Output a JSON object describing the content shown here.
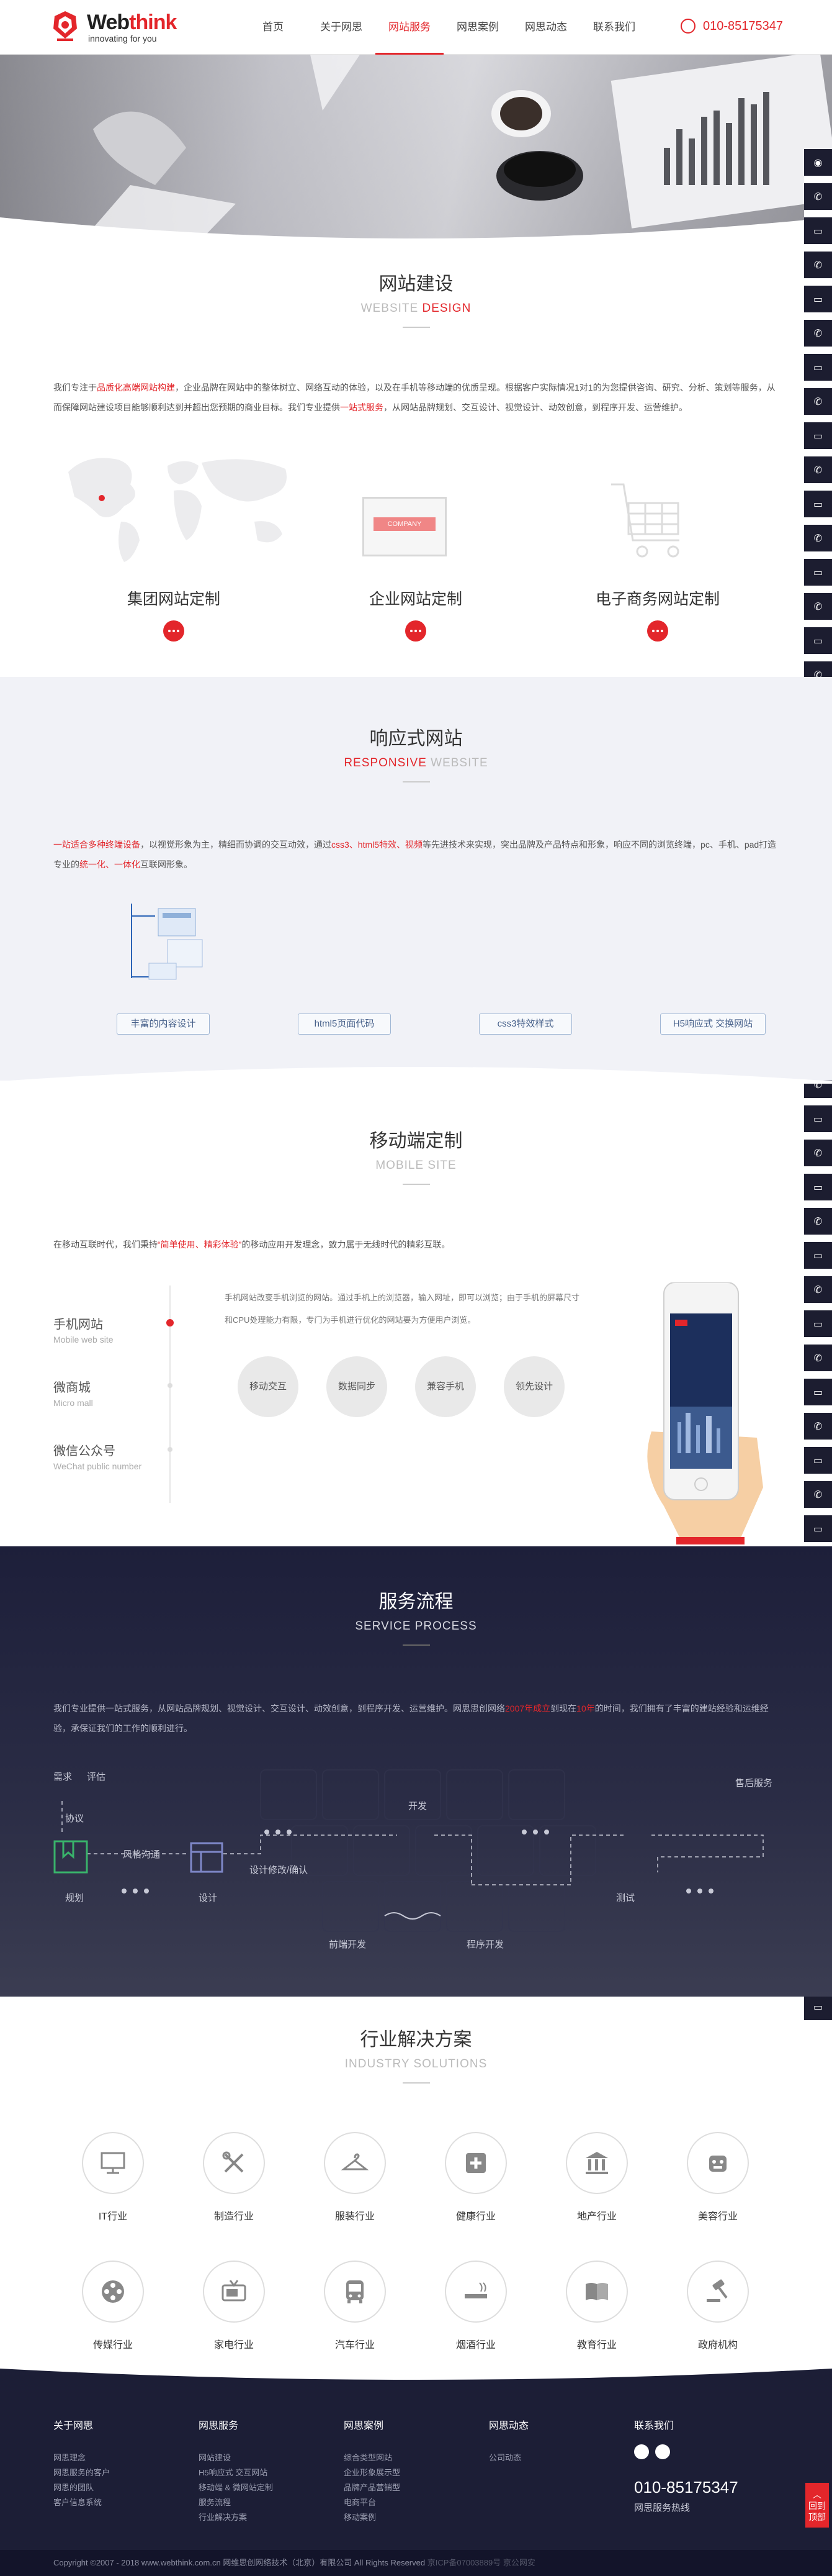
{
  "header": {
    "logo_main": "Web",
    "logo_accent": "think",
    "logo_slogan": "innovating for you",
    "nav": [
      "首页",
      "关于网思",
      "网站服务",
      "网思案例",
      "网思动态",
      "联系我们"
    ],
    "nav_active": 2,
    "phone": "010-85175347"
  },
  "website_design": {
    "title_zh": "网站建设",
    "title_en_1": "WEBSITE",
    "title_en_2": " DESIGN",
    "para_1": "我们专注于",
    "para_red_1": "品质化高端网站构建",
    "para_2": "，企业品牌在网站中的整体树立、网络互动的体验，以及在手机等移动端的优质呈现。根据客户实际情况1对1的为您提供咨询、研究、分析、策划等服务，从而保障网站建设项目能够顺利达到并超出您预期的商业目标。我们专业提供",
    "para_red_2": "一站式服务",
    "para_3": "，从网站品牌规划、交互设计、视觉设计、动效创意，到程序开发、运营维护。",
    "features": [
      {
        "label": "集团网站定制"
      },
      {
        "label": "企业网站定制",
        "badge": "COMPANY"
      },
      {
        "label": "电子商务网站定制"
      }
    ]
  },
  "responsive": {
    "title_zh": "响应式网站",
    "title_en_1": "RESPONSIVE",
    "title_en_2": " WEBSITE",
    "para_red_1": "一站适合多种终端设备",
    "para_1": "，以视觉形象为主，精细而协调的交互动效，通过",
    "para_red_2": "css3、html5特效、视频",
    "para_2": "等先进技术来实现，突出品牌及产品特点和形象，响应不同的浏览终端，pc、手机、pad打造专业的",
    "para_red_3": "统一化、一体化",
    "para_3": "互联网形象。",
    "pills": [
      "丰富的内容设计",
      "html5页面代码",
      "css3特效样式",
      "H5响应式 交换网站"
    ]
  },
  "mobile": {
    "title_zh": "移动端定制",
    "title_en": "MOBILE SITE",
    "intro_1": "在移动互联时代，我们秉持",
    "intro_red": "“简单使用、精彩体验”",
    "intro_2": "的移动应用开发理念，致力属于无线时代的精彩互联。",
    "menu": [
      {
        "zh": "手机网站",
        "en": "Mobile web site"
      },
      {
        "zh": "微商城",
        "en": "Micro mall"
      },
      {
        "zh": "微信公众号",
        "en": "WeChat public number"
      }
    ],
    "desc": "手机网站改变手机浏览的网站。通过手机上的浏览器，输入网址，即可以浏览；由于手机的屏幕尺寸和CPU处理能力有限，专门为手机进行优化的网站要为方便用户浏览。",
    "circles": [
      "移动交互",
      "数据同步",
      "兼容手机",
      "领先设计"
    ]
  },
  "process": {
    "title_zh": "服务流程",
    "title_en": "SERVICE PROCESS",
    "para_1": "我们专业提供一站式服务，从网站品牌规划、视觉设计、交互设计、动效创意，到程序开发、运营维护。网思思创网络",
    "para_red_1": "2007年成立",
    "para_2": "到现在",
    "para_red_2": "10年",
    "para_3": "的时间，我们拥有了丰富的建站经验和运维经验，承保证我们的工作的顺利进行。",
    "labels": {
      "demand": "需求",
      "evaluate": "评估",
      "protocol": "协议",
      "plan": "规划",
      "comm": "风格沟通",
      "design": "设计",
      "revise": "设计修改/确认",
      "develop": "开发",
      "front": "前端开发",
      "program": "程序开发",
      "test": "测试",
      "after": "售后服务"
    }
  },
  "industry": {
    "title_zh": "行业解决方案",
    "title_en": "INDUSTRY SOLUTIONS",
    "items": [
      {
        "label": "IT行业",
        "icon": "monitor-icon"
      },
      {
        "label": "制造行业",
        "icon": "tools-icon"
      },
      {
        "label": "服装行业",
        "icon": "hanger-icon"
      },
      {
        "label": "健康行业",
        "icon": "medical-cross-icon"
      },
      {
        "label": "地产行业",
        "icon": "building-icon"
      },
      {
        "label": "美容行业",
        "icon": "cosmetics-icon"
      },
      {
        "label": "传媒行业",
        "icon": "film-reel-icon"
      },
      {
        "label": "家电行业",
        "icon": "tv-icon"
      },
      {
        "label": "汽车行业",
        "icon": "bus-icon"
      },
      {
        "label": "烟酒行业",
        "icon": "cigarette-icon"
      },
      {
        "label": "教育行业",
        "icon": "book-icon"
      },
      {
        "label": "政府机构",
        "icon": "gavel-icon"
      }
    ]
  },
  "footer": {
    "cols": [
      {
        "title": "关于网思",
        "items": [
          "网思理念",
          "网思服务的客户",
          "网思的团队",
          "客户信息系统"
        ]
      },
      {
        "title": "网思服务",
        "items": [
          "网站建设",
          "H5响应式 交互网站",
          "移动端 & 微网站定制",
          "服务流程",
          "行业解决方案"
        ]
      },
      {
        "title": "网思案例",
        "items": [
          "综合类型网站",
          "企业形象展示型",
          "品牌产品营销型",
          "电商平台",
          "移动案例"
        ]
      },
      {
        "title": "网思动态",
        "items": [
          "公司动态"
        ]
      }
    ],
    "contact_title": "联系我们",
    "phone": "010-85175347",
    "hotline": "网思服务热线",
    "copyright": "Copyright ©2007 - 2018 www.webthink.com.cn 网维思创网络技术（北京）有限公司 All Rights Reserved",
    "icp": "京ICP备07003889号 京公网安"
  },
  "side": {
    "top_label": "回到顶部"
  },
  "colors": {
    "accent": "#e3262b",
    "dark": "#1c1e36"
  }
}
